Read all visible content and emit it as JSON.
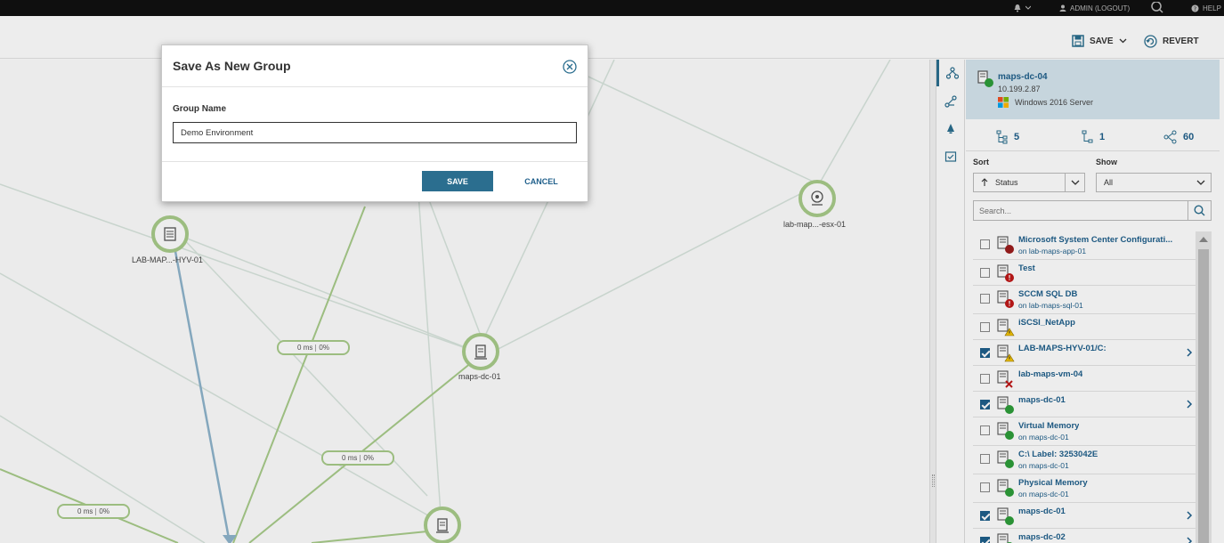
{
  "topbar": {
    "admin_label": "ADMIN (LOGOUT)",
    "help_label": "HELP"
  },
  "toolbar": {
    "save_label": "SAVE",
    "revert_label": "REVERT"
  },
  "map": {
    "nodes": [
      {
        "name": "LAB-MAP...-HYV-01"
      },
      {
        "name": "lab-map...-esx-01"
      },
      {
        "name": "maps-dc-01"
      }
    ],
    "links": [
      {
        "latency": "0 ms",
        "utilization": "0%"
      },
      {
        "latency": "0 ms",
        "utilization": "0%"
      },
      {
        "latency": "0 ms",
        "utilization": "0%"
      }
    ]
  },
  "panel": {
    "entity": {
      "name": "maps-dc-04",
      "ip": "10.199.2.87",
      "os": "Windows 2016 Server"
    },
    "counts": {
      "children": "5",
      "parents": "1",
      "connections": "60"
    },
    "sort_label": "Sort",
    "sort_value": "Status",
    "show_label": "Show",
    "show_value": "All",
    "search_placeholder": "Search...",
    "items": [
      {
        "title": "Microsoft System Center Configurati...",
        "sub": "on lab-maps-app-01",
        "checked": false,
        "status": "down",
        "chevron": false
      },
      {
        "title": "Test",
        "sub": "",
        "checked": false,
        "status": "critical",
        "chevron": false
      },
      {
        "title": "SCCM SQL DB",
        "sub": "on lab-maps-sql-01",
        "checked": false,
        "status": "critical",
        "chevron": false
      },
      {
        "title": "iSCSI_NetApp",
        "sub": "",
        "checked": false,
        "status": "warning",
        "chevron": false
      },
      {
        "title": "LAB-MAPS-HYV-01/C:",
        "sub": "",
        "checked": true,
        "status": "warning",
        "chevron": true
      },
      {
        "title": "lab-maps-vm-04",
        "sub": "",
        "checked": false,
        "status": "unmanaged",
        "chevron": false
      },
      {
        "title": "maps-dc-01",
        "sub": "",
        "checked": true,
        "status": "up",
        "chevron": true
      },
      {
        "title": "Virtual Memory",
        "sub": "on maps-dc-01",
        "checked": false,
        "status": "up",
        "chevron": false
      },
      {
        "title": "C:\\ Label: 3253042E",
        "sub": "on maps-dc-01",
        "checked": false,
        "status": "up",
        "chevron": false
      },
      {
        "title": "Physical Memory",
        "sub": "on maps-dc-01",
        "checked": false,
        "status": "up",
        "chevron": false
      },
      {
        "title": "maps-dc-01",
        "sub": "",
        "checked": true,
        "status": "up",
        "chevron": true
      },
      {
        "title": "maps-dc-02",
        "sub": "",
        "checked": true,
        "status": "up",
        "chevron": true
      }
    ]
  },
  "dialog": {
    "title": "Save As New Group",
    "field_label": "Group Name",
    "field_value": "Demo Environment",
    "save_label": "SAVE",
    "cancel_label": "CANCEL"
  },
  "colors": {
    "accent": "#2b6e8f",
    "link_text": "#1f5f8b",
    "status_up": "#2e9e3a",
    "status_down": "#9b1c1c",
    "status_warning": "#f5c400",
    "node_ring": "#a8cc8a"
  }
}
